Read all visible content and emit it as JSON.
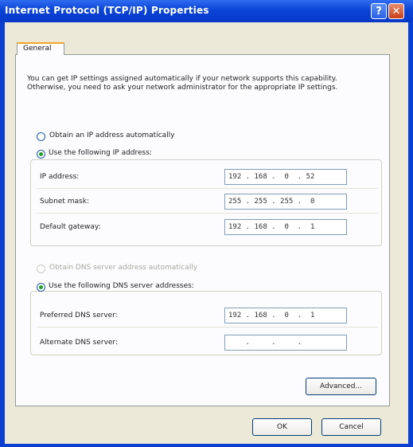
{
  "window": {
    "title": "Internet Protocol (TCP/IP) Properties"
  },
  "titlebar_buttons": {
    "help": "?",
    "close": "✕"
  },
  "tabs": [
    {
      "label": "General"
    }
  ],
  "description": "You can get IP settings assigned automatically if your network supports this capability. Otherwise, you need to ask your network administrator for the appropriate IP settings.",
  "ip_section": {
    "auto_label": "Obtain an IP address automatically",
    "manual_label": "Use the following IP address:",
    "selected": "manual",
    "fields": [
      {
        "label": "IP address:",
        "value": "192 . 168 .  0  . 52"
      },
      {
        "label": "Subnet mask:",
        "value": "255 . 255 . 255 .  0"
      },
      {
        "label": "Default gateway:",
        "value": "192 . 168 .  0  .  1"
      }
    ]
  },
  "dns_section": {
    "auto_label": "Obtain DNS server address automatically",
    "manual_label": "Use the following DNS server addresses:",
    "selected": "manual",
    "fields": [
      {
        "label": "Preferred DNS server:",
        "value": "192 . 168 .  0  .  1"
      },
      {
        "label": "Alternate DNS server:",
        "value": "    .     .     .    "
      }
    ]
  },
  "buttons": {
    "advanced": "Advanced...",
    "ok": "OK",
    "cancel": "Cancel"
  },
  "colors": {
    "titlebar": "#0a44d6",
    "dialog": "#ece9d8",
    "tab_accent": "#f5a623",
    "radio_dot": "#21a121"
  }
}
